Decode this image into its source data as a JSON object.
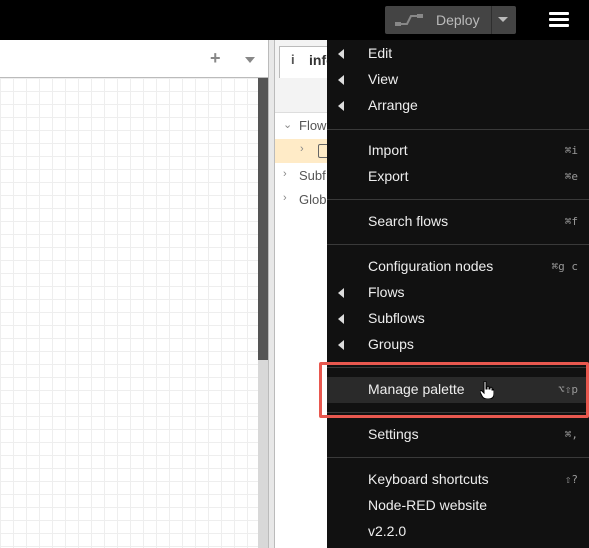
{
  "header": {
    "deploy_label": "Deploy",
    "deploy_icon": "deploy-icon",
    "menu_icon": "hamburger-icon"
  },
  "workspace": {
    "add_tab_symbol": "+",
    "tab_menu_icon": "chevron-down-icon"
  },
  "sidebar": {
    "tab_icon_symbol": "i",
    "tab_label": "info",
    "tree": [
      {
        "chevron": "⌄",
        "label": "Flow"
      },
      {
        "chevron": "›",
        "label": "Subf"
      },
      {
        "chevron": "›",
        "label": "Glob"
      }
    ],
    "selected_chevron": "›"
  },
  "menu": {
    "items": [
      {
        "label": "Edit",
        "shortcut": "",
        "submenu": true
      },
      {
        "label": "View",
        "shortcut": "",
        "submenu": true
      },
      {
        "label": "Arrange",
        "shortcut": "",
        "submenu": true
      },
      {
        "label": "Import",
        "shortcut": "⌘i",
        "submenu": false
      },
      {
        "label": "Export",
        "shortcut": "⌘e",
        "submenu": false
      },
      {
        "label": "Search flows",
        "shortcut": "⌘f",
        "submenu": false
      },
      {
        "label": "Configuration nodes",
        "shortcut": "⌘g c",
        "submenu": false
      },
      {
        "label": "Flows",
        "shortcut": "",
        "submenu": true
      },
      {
        "label": "Subflows",
        "shortcut": "",
        "submenu": true
      },
      {
        "label": "Groups",
        "shortcut": "",
        "submenu": true
      },
      {
        "label": "Manage palette",
        "shortcut": "⌥⇧p",
        "submenu": false,
        "highlighted": true
      },
      {
        "label": "Settings",
        "shortcut": "⌘,",
        "submenu": false
      },
      {
        "label": "Keyboard shortcuts",
        "shortcut": "⇧?",
        "submenu": false
      },
      {
        "label": "Node-RED website",
        "shortcut": "",
        "submenu": false
      },
      {
        "label": "v2.2.0",
        "shortcut": "",
        "submenu": false
      }
    ]
  },
  "colors": {
    "menu_bg": "#111111",
    "callout": "#e8584f",
    "selected_row": "#ffebc7"
  }
}
